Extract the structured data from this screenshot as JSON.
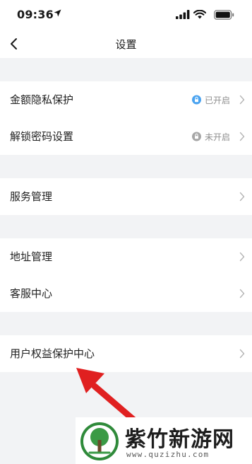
{
  "status_bar": {
    "time": "09:36"
  },
  "header": {
    "title": "设置"
  },
  "rows": [
    {
      "label": "金额隐私保护",
      "status": "已开启",
      "status_color": "#4aa3f0"
    },
    {
      "label": "解锁密码设置",
      "status": "未开启",
      "status_color": "#a6a6a6"
    },
    {
      "label": "服务管理"
    },
    {
      "label": "地址管理"
    },
    {
      "label": "客服中心"
    },
    {
      "label": "用户权益保护中心"
    }
  ],
  "watermark": {
    "title": "紫竹新游网",
    "url": "www.quzizhu.com"
  },
  "colors": {
    "page_background": "#f2f3f5",
    "row_background": "#ffffff",
    "annotation_arrow": "#e02020",
    "watermark_logo": "#2f8a3a"
  }
}
